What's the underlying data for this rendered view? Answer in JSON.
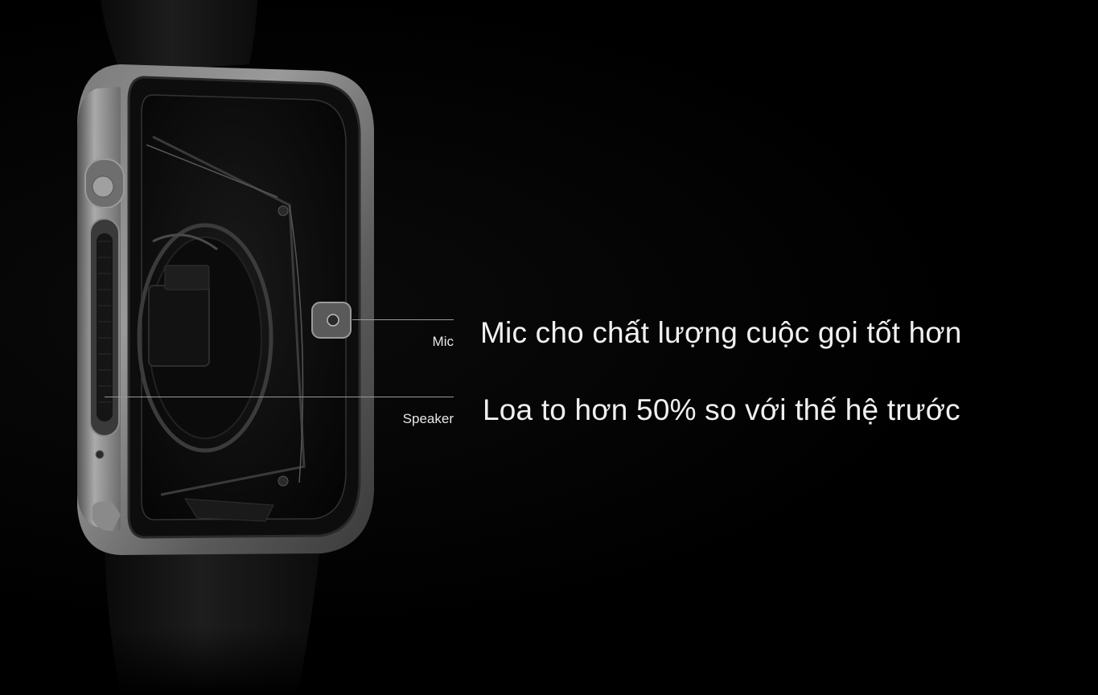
{
  "callouts": [
    {
      "label": "Mic",
      "description": "Mic cho chất lượng cuộc gọi tốt hơn"
    },
    {
      "label": "Speaker",
      "description": "Loa to hơn 50% so với thế hệ trước"
    }
  ],
  "colors": {
    "background": "#000000",
    "text": "#f0f0f0",
    "line": "#9a9a9a"
  }
}
